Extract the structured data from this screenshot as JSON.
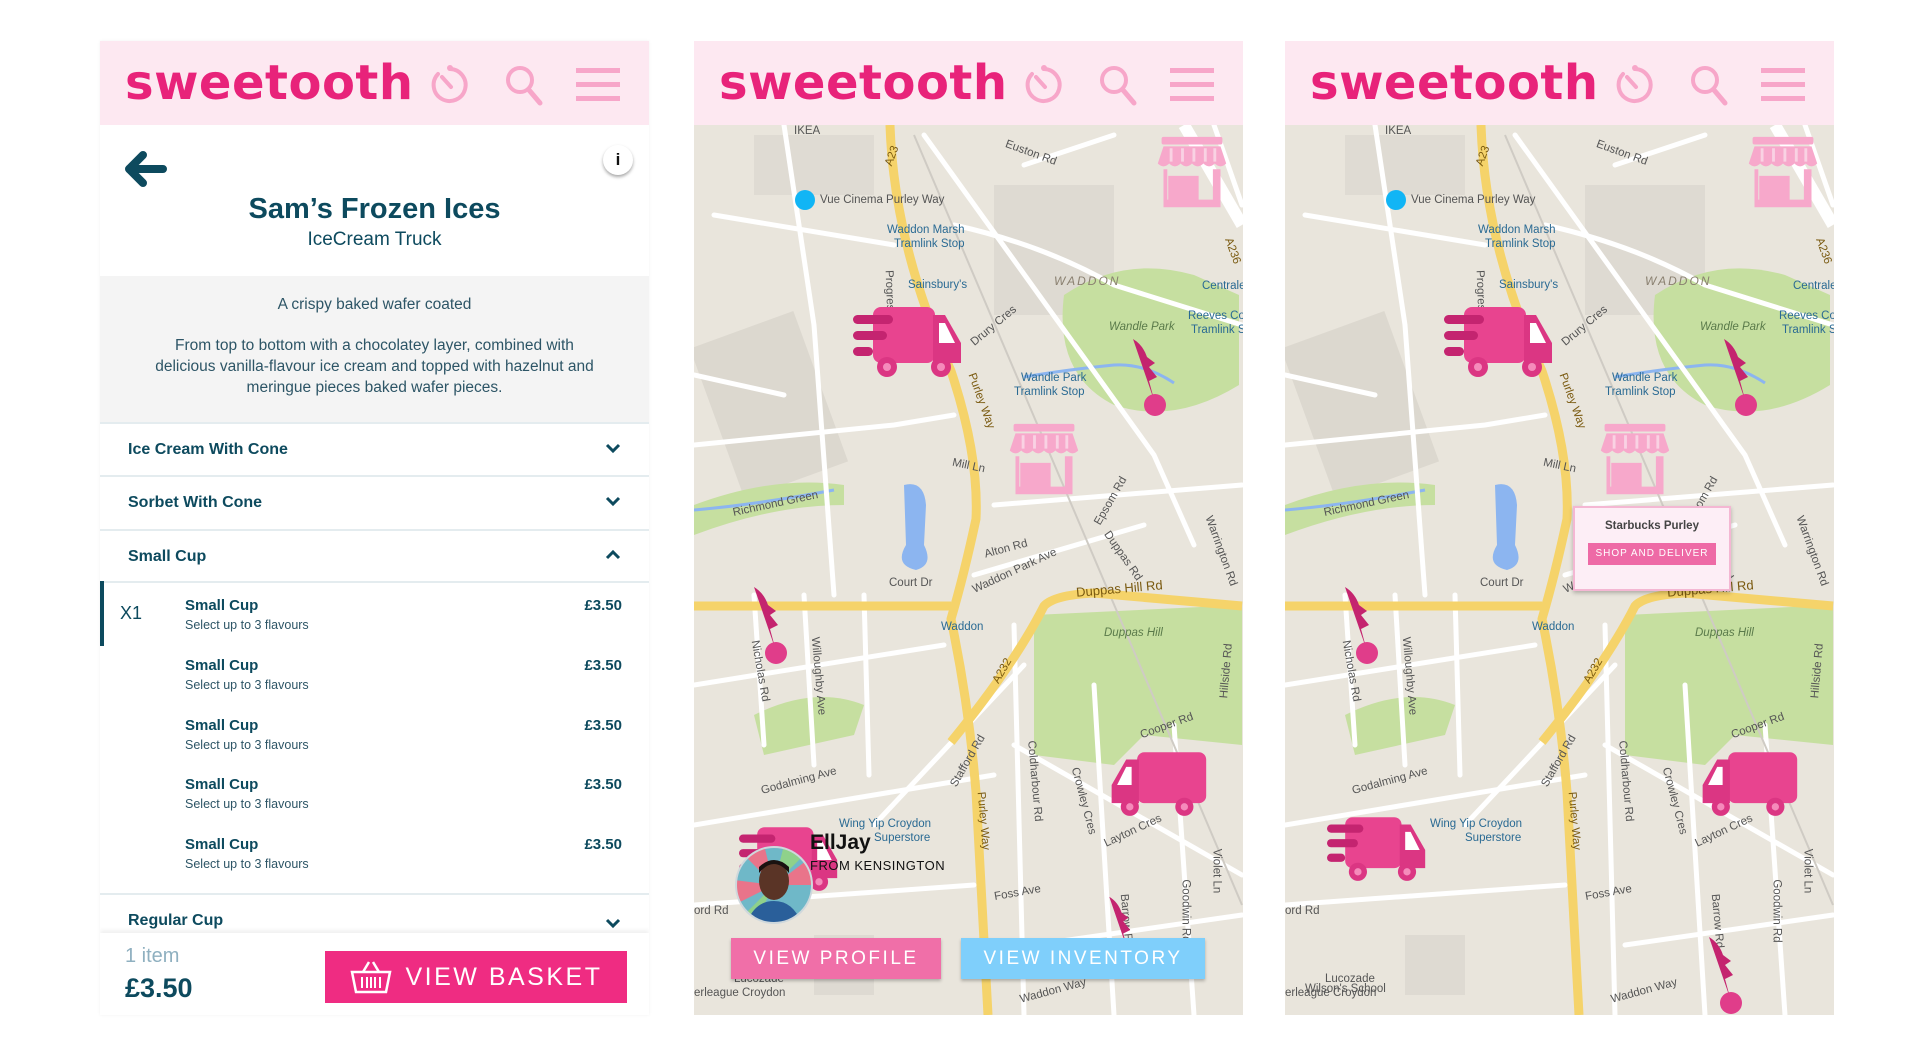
{
  "app": {
    "logo": "sweetooth",
    "icons": [
      "timer-icon",
      "search-icon",
      "menu-icon"
    ],
    "brand_color": "#e8237a",
    "header_bg": "#fde8f1"
  },
  "menu_screen": {
    "title": "Sam’s Frozen Ices",
    "subtitle": "IceCream Truck",
    "info_label": "i",
    "description": {
      "line1": "A crispy baked wafer coated",
      "line2": "From top to bottom with a chocolatey layer, combined with delicious vanilla-flavour ice cream and topped with hazelnut and meringue pieces baked wafer pieces."
    },
    "categories": [
      {
        "label": "Ice Cream With Cone",
        "expanded": false
      },
      {
        "label": "Sorbet With Cone",
        "expanded": false
      },
      {
        "label": "Small Cup",
        "expanded": true
      },
      {
        "label": "Regular Cup",
        "expanded": false
      }
    ],
    "items": [
      {
        "name": "Small Cup",
        "desc": "Select up to 3 flavours",
        "price": "£3.50",
        "qty": "X1"
      },
      {
        "name": "Small Cup",
        "desc": "Select up to 3 flavours",
        "price": "£3.50"
      },
      {
        "name": "Small Cup",
        "desc": "Select up to 3 flavours",
        "price": "£3.50"
      },
      {
        "name": "Small Cup",
        "desc": "Select up to 3 flavours",
        "price": "£3.50"
      },
      {
        "name": "Small Cup",
        "desc": "Select up to 3 flavours",
        "price": "£3.50"
      }
    ],
    "footer": {
      "count": "1 item",
      "total": "£3.50",
      "button": "VIEW BASKET",
      "button_color": "#ef2c82"
    }
  },
  "map_labels": [
    "IKEA",
    "Euston Rd",
    "Vue Cinema Purley Way",
    "Waddon Marsh",
    "Tramlink Stop",
    "Sainsbury's",
    "WADDON",
    "Centrale",
    "Wandle Park",
    "Reeves Co",
    "Tramlink S",
    "Drury Cres",
    "Wandle Park",
    "Tramlink Stop",
    "Purley Way",
    "Mill Ln",
    "Richmond Green",
    "Epsom Rd",
    "Alton Rd",
    "Court Dr",
    "Waddon Park Ave",
    "Duppas Hill Rd",
    "Waddon",
    "Duppas Hill",
    "A232",
    "Cooper Rd",
    "Godalming Ave",
    "Stafford Rd",
    "Purley Way",
    "Coldharbour Rd",
    "Crowley Cres",
    "Layton Cres",
    "Wing Yip Croydon",
    "Superstore",
    "Foss Ave",
    "Violet Ln",
    "Goodwin Rd",
    "Waddon Way",
    "Lucozade",
    "erleague Croydon",
    "A23",
    "Hillside Rd",
    "Nicholas Rd",
    "Willoughby Ave",
    "ord Rd",
    "Progress Way",
    "Warrington Rd",
    "Duppas Rd",
    "A236",
    "Barrow Rd"
  ],
  "profile_screen": {
    "driver_name": "EllJay",
    "driver_from": "FROM KENSINGTON",
    "view_profile": "VIEW PROFILE",
    "view_inventory": "VIEW INVENTORY",
    "profile_color": "#f06fa8",
    "inventory_color": "#7fcffb"
  },
  "shop_screen": {
    "popup_title": "Starbucks Purley",
    "popup_button": "SHOP AND DELIVER",
    "extra_label": "Wilson's School"
  }
}
